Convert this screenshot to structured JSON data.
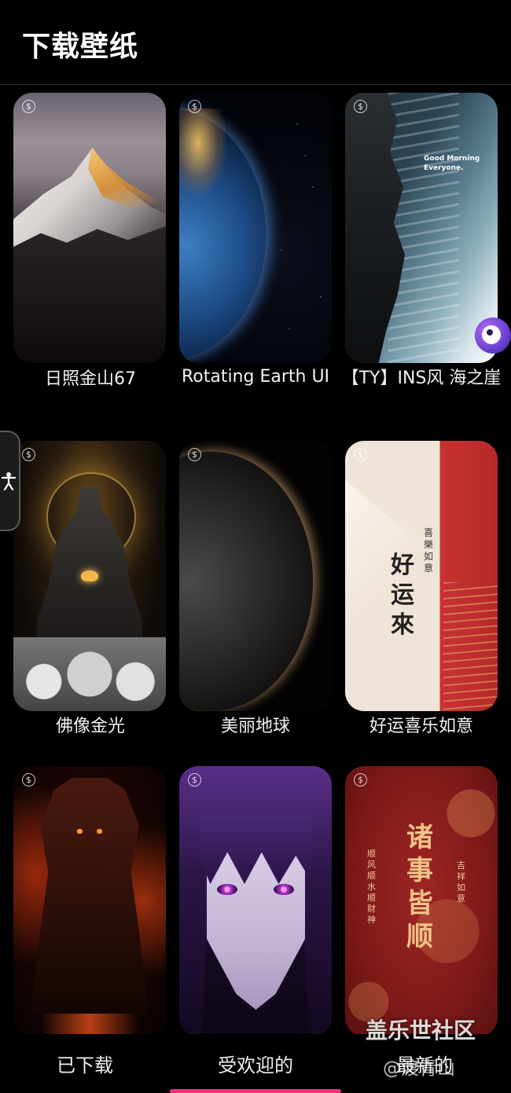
{
  "header": {
    "title": "下载壁纸"
  },
  "wallpapers": [
    {
      "label": "日照金山67",
      "price_icon": "$"
    },
    {
      "label": "Rotating Earth UI",
      "price_icon": "$"
    },
    {
      "label": "【TY】INS风 海之崖",
      "price_icon": "$",
      "art_text": "Good Morning\nEveryone."
    },
    {
      "label": "佛像金光",
      "price_icon": "$"
    },
    {
      "label": "美丽地球",
      "price_icon": "$"
    },
    {
      "label": "好运喜乐如意",
      "price_icon": "$",
      "art_big": "好运來",
      "art_small": "喜樂如意"
    },
    {
      "label": "",
      "price_icon": "$"
    },
    {
      "label": "",
      "price_icon": "$"
    },
    {
      "label": "",
      "price_icon": "$",
      "art_big": "诸事皆顺",
      "art_left": "顺风顺水顺财神",
      "art_right": "吉祥如意"
    }
  ],
  "bottom_nav": {
    "downloaded": "已下载",
    "popular": "受欢迎的",
    "newest": "最新的"
  },
  "watermark": {
    "line1": "盖乐世社区",
    "line2": "@渡青山"
  },
  "colors": {
    "accent": "#e8357a",
    "background": "#000000"
  }
}
